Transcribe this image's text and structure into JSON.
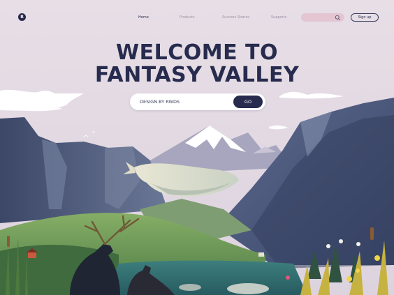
{
  "logo": {
    "mark": "R"
  },
  "nav": {
    "links": [
      "Home",
      "Products",
      "Success Stories",
      "Supports"
    ],
    "active": "Home",
    "search": {
      "placeholder": "",
      "icon": "search-icon"
    },
    "signup_label": "Sign up"
  },
  "hero": {
    "title_line1": "WELCOME TO",
    "title_line2": "FANTASY VALLEY",
    "input_value": "DESIGN BY RWDS",
    "button_label": "GO"
  },
  "colors": {
    "sky": "#e6dde4",
    "title": "#272b4e",
    "search_pill": "#e3c6d2",
    "button": "#272b4e",
    "mountain": "#4b5877",
    "valley_green": "#6f9a55",
    "lake": "#2f6a6d"
  }
}
